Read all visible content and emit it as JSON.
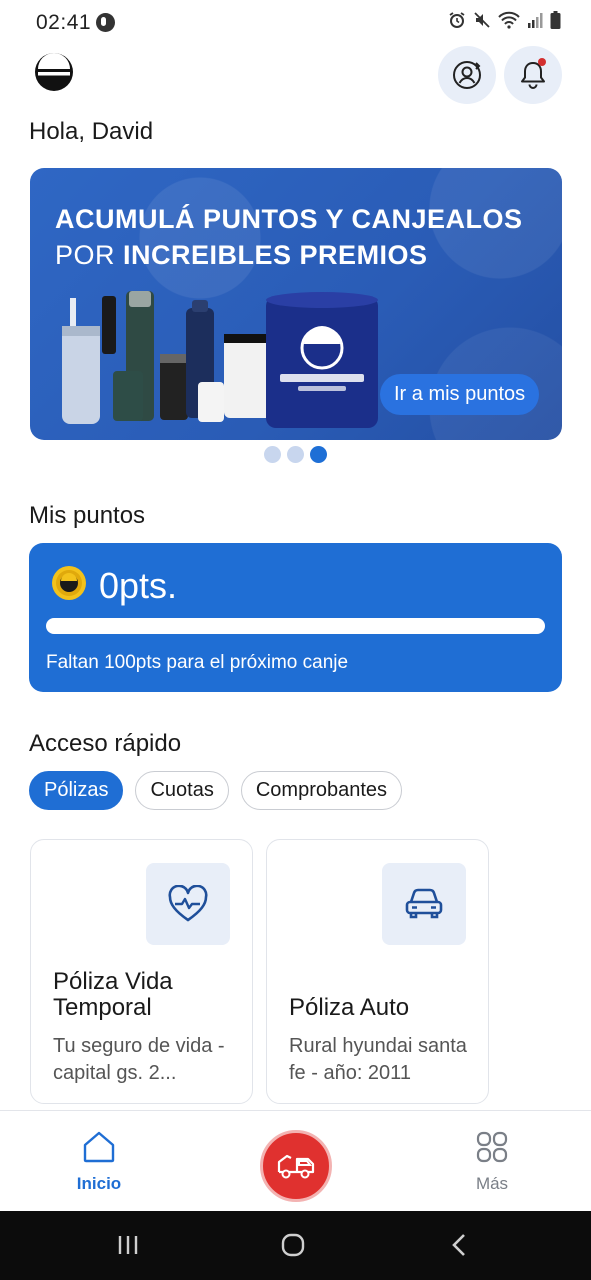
{
  "status_bar": {
    "time": "02:41",
    "icons": [
      "app-notification-icon",
      "alarm-icon",
      "mute-icon",
      "wifi-icon",
      "signal-icon",
      "battery-icon"
    ]
  },
  "header": {
    "logo": "la-consolidada-logo",
    "profile_icon": "profile-sync-icon",
    "notification_icon": "bell-icon",
    "notification_badge": true,
    "greeting": "Hola, David"
  },
  "banner": {
    "headline_line1": "ACUMULÁ PUNTOS Y CANJEALOS",
    "headline_line2_prefix": "POR",
    "headline_line2_bold": "INCREIBLES PREMIOS",
    "cta_label": "Ir a mis puntos",
    "slides_count": 3,
    "active_slide": 3
  },
  "points": {
    "section_title": "Mis puntos",
    "value": "0pts.",
    "progress_fraction": 0,
    "note": "Faltan 100pts para el próximo canje"
  },
  "quick_access": {
    "section_title": "Acceso rápido",
    "chips": [
      {
        "label": "Pólizas",
        "active": true
      },
      {
        "label": "Cuotas",
        "active": false
      },
      {
        "label": "Comprobantes",
        "active": false
      }
    ],
    "cards": [
      {
        "icon": "heart-pulse-icon",
        "title": "Póliza Vida Temporal",
        "description": "Tu seguro de vida - capital gs. 2..."
      },
      {
        "icon": "car-icon",
        "title": "Póliza Auto",
        "description": "Rural hyundai santa fe - año: 2011"
      }
    ]
  },
  "bottom_nav": {
    "home_label": "Inicio",
    "center_icon": "tow-truck-icon",
    "more_label": "Más"
  },
  "colors": {
    "primary": "#1f6ed4",
    "sos": "#e0312f",
    "icon_bg": "#e8eef8"
  }
}
